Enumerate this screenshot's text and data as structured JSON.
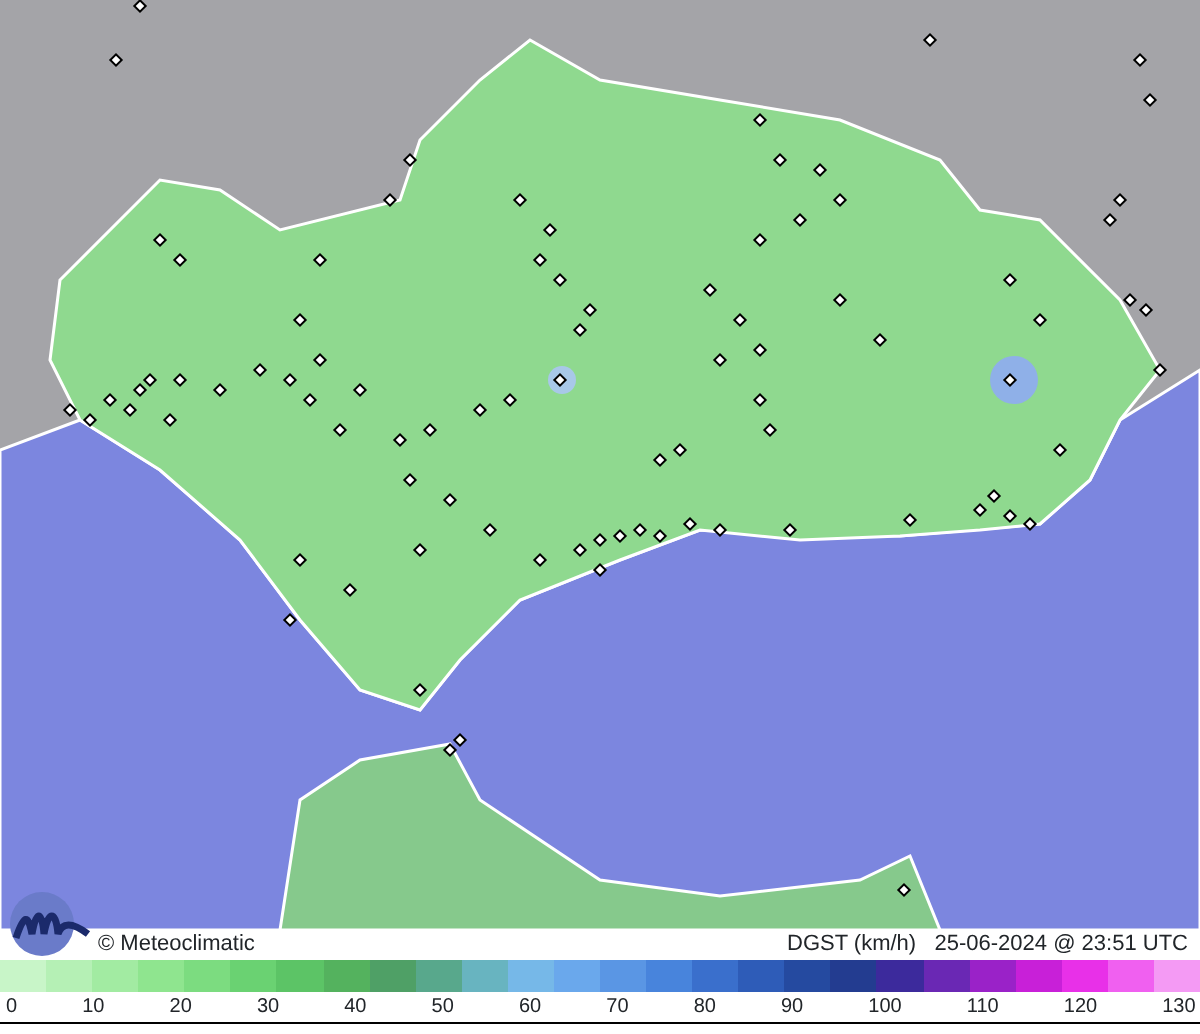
{
  "map": {
    "credit": "© Meteoclimatic",
    "variable": "DGST (km/h)",
    "timestamp": "25-06-2024 @ 23:51 UTC"
  },
  "legend": {
    "ticks": [
      "0",
      "10",
      "20",
      "30",
      "40",
      "50",
      "60",
      "70",
      "80",
      "90",
      "100",
      "110",
      "120",
      "130"
    ]
  }
}
